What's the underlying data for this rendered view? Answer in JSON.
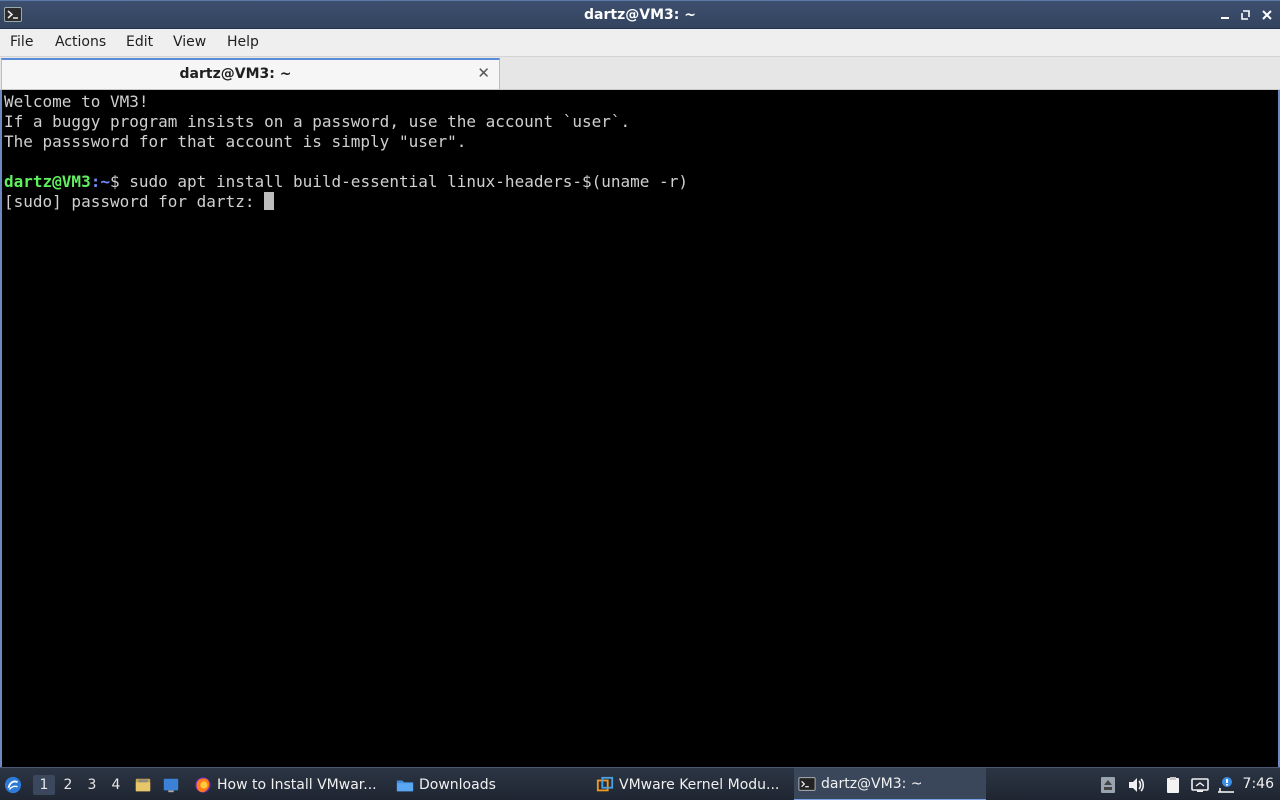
{
  "window": {
    "title": "dartz@VM3: ~"
  },
  "menu": [
    "File",
    "Actions",
    "Edit",
    "View",
    "Help"
  ],
  "tab": {
    "label": "dartz@VM3: ~",
    "close": "✕"
  },
  "terminal": {
    "lines": [
      "Welcome to VM3!",
      "If a buggy program insists on a password, use the account `user`.",
      "The passsword for that account is simply \"user\"."
    ],
    "prompt_user": "dartz@VM3",
    "prompt_sep": ":",
    "prompt_path": "~",
    "prompt_end": "$ ",
    "command": "sudo apt install build-essential linux-headers-$(uname -r)",
    "sudo_prompt": "[sudo] password for dartz: "
  },
  "taskbar": {
    "workspaces": [
      "1",
      "2",
      "3",
      "4"
    ],
    "active_workspace": "1",
    "tasks": [
      {
        "label": "How to Install VMwar...",
        "icon": "firefox-icon"
      },
      {
        "label": "Downloads",
        "icon": "folder-icon"
      },
      {
        "label": "VMware Kernel Modu...",
        "icon": "vmware-icon"
      },
      {
        "label": "dartz@VM3: ~",
        "icon": "terminal-icon"
      }
    ],
    "clock": "7:46"
  },
  "colors": {
    "prompt_user": "#5ff05f",
    "prompt_path": "#6f8cff",
    "accent": "#5a8bd6"
  }
}
